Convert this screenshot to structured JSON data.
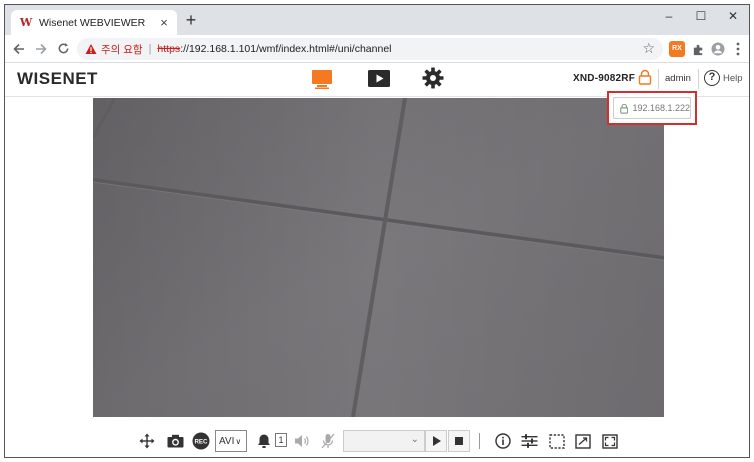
{
  "browser": {
    "tab_title": "Wisenet WEBVIEWER",
    "tab_favicon": "W",
    "tab_close": "×",
    "new_tab": "+",
    "controls": {
      "minimize": "–",
      "maximize": "☐",
      "close": "✕"
    },
    "address": {
      "warning_text": "주의 요함",
      "separator": "|",
      "scheme": "https",
      "rest": "://192.168.1.101/wmf/index.html#/uni/channel"
    },
    "extension_label": "RX"
  },
  "app": {
    "logo": "WISENET",
    "device_name": "XND-9082RF",
    "user": "admin",
    "help_label": "Help",
    "help_icon_glyph": "?",
    "ip_popup": "192.168.1.222",
    "accent_color": "#f47920",
    "warning_color": "#d32f2f"
  },
  "controls": {
    "format_value": "AVI",
    "format_chevron": "∨",
    "alarm_count": "1",
    "profile_chevron": "⌄",
    "icons": [
      "ptz-move-icon",
      "snapshot-icon",
      "rec-icon",
      "alarm-bell-icon",
      "speaker-icon",
      "mic-muted-icon",
      "play-icon",
      "stop-icon",
      "info-icon",
      "adjust-icon",
      "roi-icon",
      "fit-icon",
      "fullscreen-icon"
    ]
  }
}
